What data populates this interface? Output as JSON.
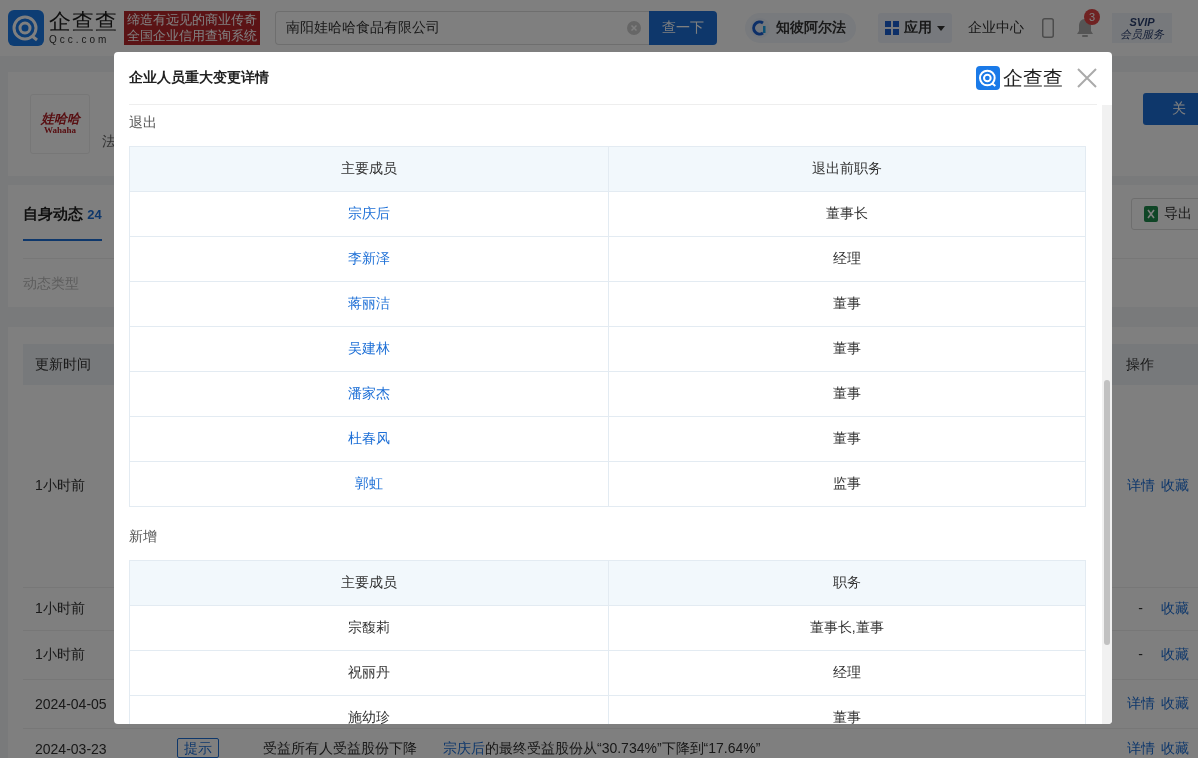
{
  "top_bar": {
    "logo": {
      "name": "企查查",
      "domain": "Qcc.com"
    },
    "slogan": [
      "缔造有远见的商业传奇",
      "全国企业信用查询系统"
    ],
    "search": {
      "value": "南阳娃哈哈食品有限公司",
      "button": "查一下"
    },
    "nav": [
      {
        "kind": "brand",
        "label": "知彼阿尔法"
      },
      {
        "kind": "menu",
        "label": "应用"
      },
      {
        "kind": "link",
        "label": "企业中心"
      },
      {
        "kind": "phone"
      },
      {
        "kind": "bell",
        "badge": "3"
      },
      {
        "kind": "vip",
        "label": "SVIP",
        "sub": "会员服务"
      }
    ]
  },
  "company": {
    "logo_text": "娃哈哈",
    "logo_latin": "Wahaha",
    "line": "法",
    "follow": "关"
  },
  "tabs": [
    {
      "label": "自身动态",
      "count": "24",
      "selected": true
    }
  ],
  "filter_label": "动态类型",
  "export": "导出",
  "table": {
    "columns": [
      "更新时间",
      "操作"
    ],
    "rows": [
      {
        "time": "1小时前",
        "actions": [
          {
            "label": "详情",
            "link": true
          },
          {
            "label": "收藏",
            "link": true
          }
        ]
      },
      {
        "time": "1小时前",
        "actions": [
          {
            "label": "-",
            "link": false
          },
          {
            "label": "收藏",
            "link": true
          }
        ]
      },
      {
        "time": "1小时前",
        "actions": [
          {
            "label": "-",
            "link": false
          },
          {
            "label": "收藏",
            "link": true
          }
        ]
      },
      {
        "time": "2024-04-05",
        "actions": [
          {
            "label": "详情",
            "link": true
          },
          {
            "label": "收藏",
            "link": true
          }
        ]
      },
      {
        "time": "2024-03-23",
        "tag": "提示",
        "type": "受益所有人受益股份下降",
        "content_link": "宗庆后",
        "content": "的最终受益股份从“30.734%”下降到“17.64%”",
        "actions": [
          {
            "label": "详情",
            "link": true
          },
          {
            "label": "收藏",
            "link": true
          }
        ]
      }
    ]
  },
  "modal": {
    "title": "企业人员重大变更详情",
    "logo": "企查查",
    "sections": [
      {
        "heading": "退出",
        "columns": [
          "主要成员",
          "退出前职务"
        ],
        "rows": [
          {
            "member": "宗庆后",
            "role": "董事长",
            "linked": true
          },
          {
            "member": "李新泽",
            "role": "经理",
            "linked": true
          },
          {
            "member": "蒋丽洁",
            "role": "董事",
            "linked": true
          },
          {
            "member": "吴建林",
            "role": "董事",
            "linked": true
          },
          {
            "member": "潘家杰",
            "role": "董事",
            "linked": true
          },
          {
            "member": "杜春风",
            "role": "董事",
            "linked": true
          },
          {
            "member": "郭虹",
            "role": "监事",
            "linked": true
          }
        ]
      },
      {
        "heading": "新增",
        "columns": [
          "主要成员",
          "职务"
        ],
        "rows": [
          {
            "member": "宗馥莉",
            "role": "董事长,董事",
            "linked": false
          },
          {
            "member": "祝丽丹",
            "role": "经理",
            "linked": false
          },
          {
            "member": "施幼珍",
            "role": "董事",
            "linked": false
          }
        ]
      }
    ]
  }
}
